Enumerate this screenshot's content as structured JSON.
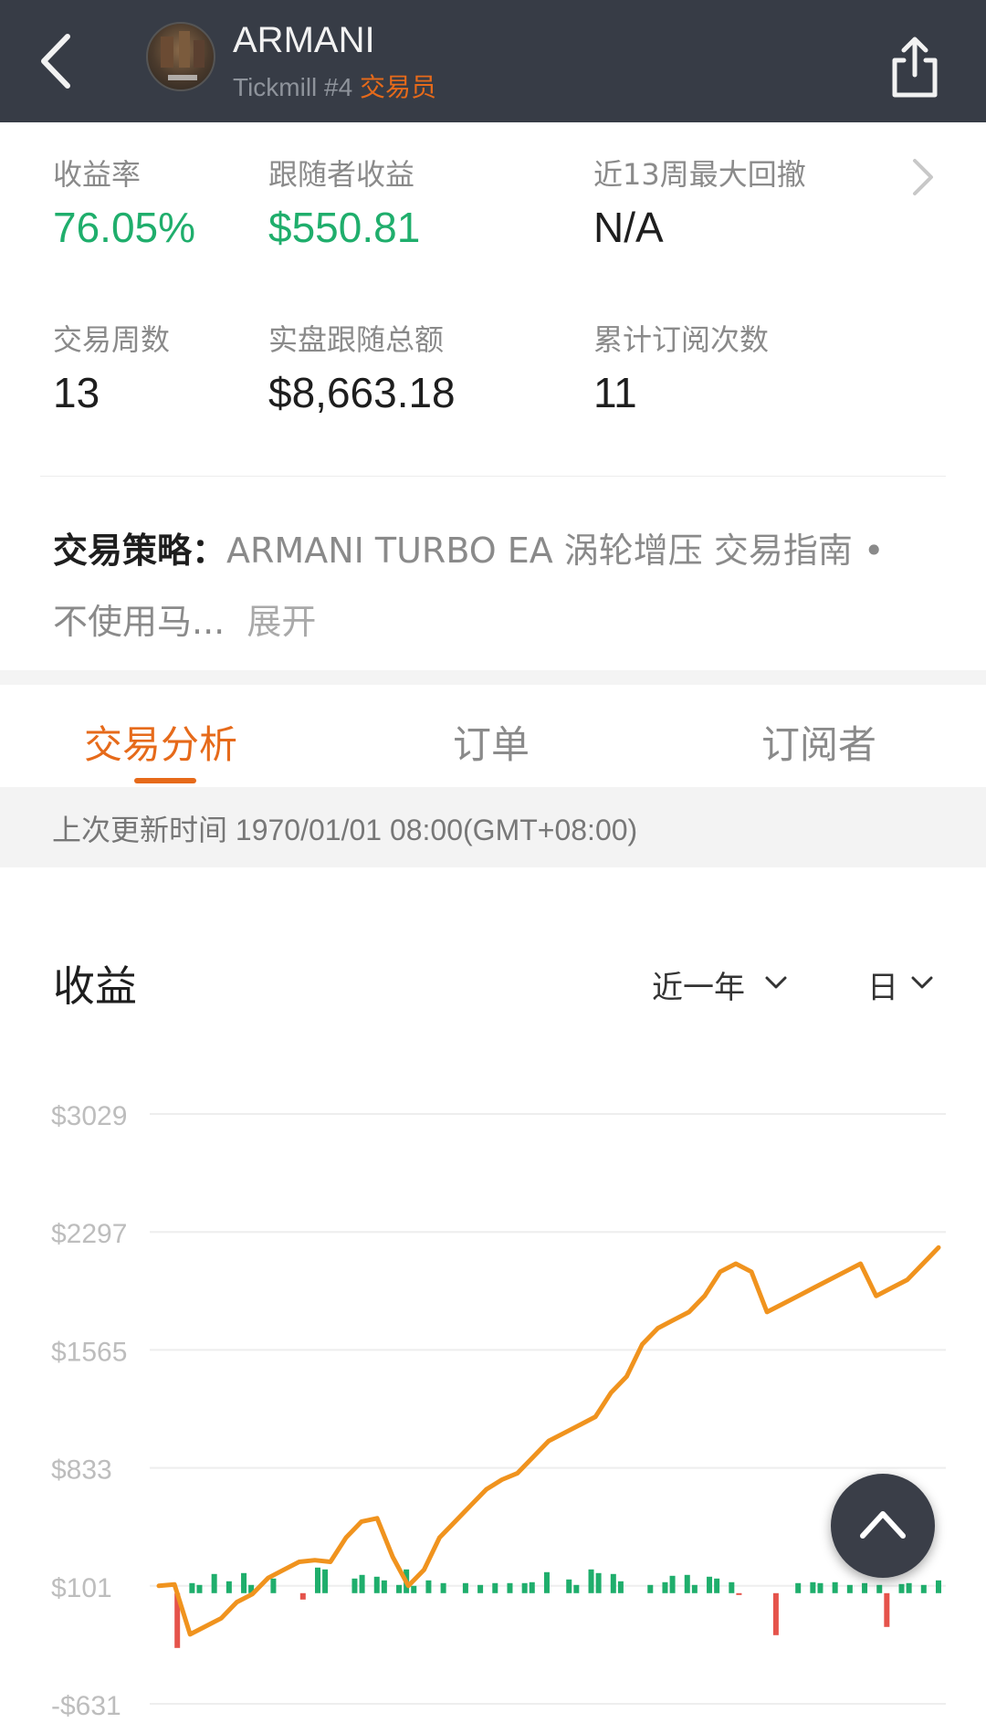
{
  "header": {
    "name": "ARMANI",
    "broker": "Tickmill #4",
    "role": "交易员"
  },
  "stats": [
    {
      "label": "收益率",
      "value": "76.05%"
    },
    {
      "label": "跟随者收益",
      "value": "$550.81"
    },
    {
      "label": "近13周最大回撤",
      "value": "N/A"
    },
    {
      "label": "交易周数",
      "value": "13"
    },
    {
      "label": "实盘跟随总额",
      "value": "$8,663.18"
    },
    {
      "label": "累计订阅次数",
      "value": "11"
    }
  ],
  "strategy": {
    "title": "交易策略：",
    "text": "ARMANI TURBO EA 涡轮增压 交易指南 • 不使用马...",
    "more": "展开"
  },
  "tabs": [
    {
      "label": "交易分析",
      "active": true
    },
    {
      "label": "订单",
      "active": false
    },
    {
      "label": "订阅者",
      "active": false
    }
  ],
  "update_text": "上次更新时间 1970/01/01 08:00(GMT+08:00)",
  "chart_section": {
    "title": "收益",
    "range_select": "近一年",
    "period_select": "日"
  },
  "colors": {
    "header_bg": "#373c46",
    "accent": "#e66a1a",
    "green": "#1fae6c",
    "red": "#e5534b",
    "line": "#f0931e"
  },
  "chart_data": {
    "type": "line",
    "ylim": [
      -631,
      3029
    ],
    "yticks": [
      "$3029",
      "$2297",
      "$1565",
      "$833",
      "$101",
      "-$631"
    ],
    "grid": true,
    "series": [
      {
        "values": [
          101,
          110,
          -200,
          -150,
          -100,
          0,
          50,
          150,
          200,
          250,
          260,
          250,
          400,
          500,
          520,
          280,
          101,
          200,
          400,
          500,
          600,
          700,
          760,
          800,
          900,
          1000,
          1050,
          1100,
          1150,
          1300,
          1400,
          1600,
          1700,
          1750,
          1800,
          1900,
          2050,
          2100,
          2050,
          1800,
          1850,
          1900,
          1950,
          2000,
          2050,
          2100,
          1900,
          1950,
          2000,
          2100,
          2200
        ]
      },
      {
        "values": [
          0,
          0,
          -300,
          0,
          55,
          45,
          0,
          105,
          0,
          65,
          0,
          110,
          45,
          0,
          0,
          80,
          0,
          0,
          0,
          -35,
          0,
          140,
          130,
          0,
          0,
          0,
          80,
          100,
          0,
          90,
          70,
          0,
          45,
          130,
          40,
          0,
          70,
          0,
          55,
          0,
          0,
          55,
          0,
          45,
          0,
          55,
          0,
          55,
          0,
          55,
          60,
          0,
          115,
          0,
          0,
          75,
          45,
          0,
          130,
          110,
          0,
          105,
          65,
          0,
          0,
          0,
          45,
          0,
          60,
          95,
          0,
          100,
          45,
          0,
          90,
          80,
          0,
          60,
          -10,
          0,
          0,
          0,
          0,
          -230,
          0,
          0,
          55,
          0,
          60,
          55,
          0,
          60,
          0,
          45,
          0,
          55,
          0,
          45,
          -185,
          0,
          50,
          55,
          0,
          45,
          0,
          70
        ]
      }
    ]
  }
}
